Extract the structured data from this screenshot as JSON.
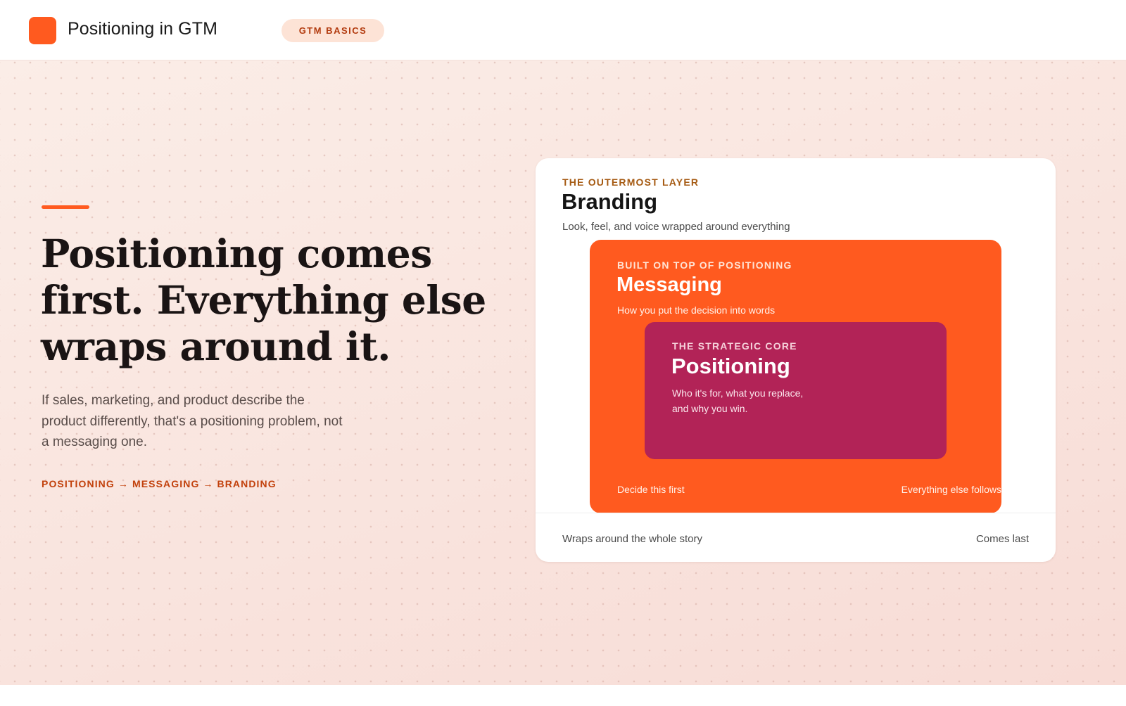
{
  "header": {
    "title": "Positioning in GTM",
    "badge": "GTM BASICS",
    "logo_color": "#ff5a1f"
  },
  "hero": {
    "headline": "Positioning comes first. Everything else wraps around it.",
    "subtext": "If sales, marketing, and product describe the product differently, that's a positioning problem, not a messaging one.",
    "flow": "POSITIONING → MESSAGING → BRANDING"
  },
  "diagram": {
    "branding": {
      "eyebrow": "THE OUTERMOST LAYER",
      "title": "Branding",
      "description": "Look, feel, and voice wrapped around everything",
      "footer_left": "Wraps around the whole story",
      "footer_right": "Comes last"
    },
    "messaging": {
      "eyebrow": "BUILT ON TOP OF POSITIONING",
      "title": "Messaging",
      "description": "How you put the decision into words",
      "footer_left": "Decide this first",
      "footer_right": "Everything else follows",
      "color": "#ff5a1f"
    },
    "positioning": {
      "eyebrow": "THE STRATEGIC CORE",
      "title": "Positioning",
      "description": "Who it's for, what you replace, and why you win.",
      "color": "#b22357"
    }
  }
}
